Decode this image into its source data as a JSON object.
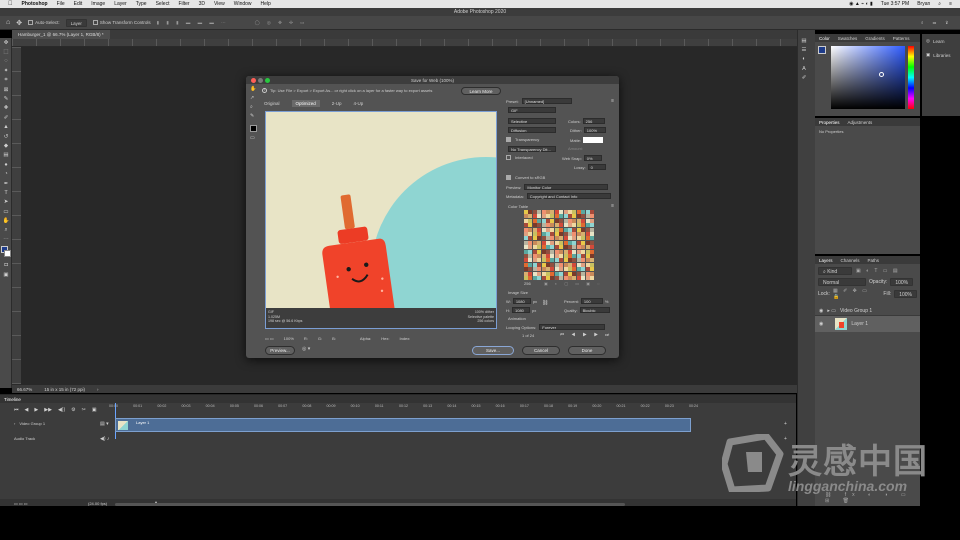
{
  "mac_menu": {
    "apple": "",
    "app": "Photoshop",
    "items": [
      "File",
      "Edit",
      "Image",
      "Layer",
      "Type",
      "Select",
      "Filter",
      "3D",
      "View",
      "Window",
      "Help"
    ],
    "time": "Tue 3:57 PM",
    "user": "Bryan"
  },
  "window_title": "Adobe Photoshop 2020",
  "options_bar": {
    "auto_select": "Auto-Select:",
    "layer_value": "Layer",
    "show_transform": "Show Transform Controls"
  },
  "doc_tab": "Hamburger_1 @ 66.7% (Layer 1, RGB/8) *",
  "doc_status": {
    "zoom": "66.67%",
    "info": "15 in x 15 in (72 ppi)"
  },
  "color_panel": {
    "tabs": [
      "Color",
      "Swatches",
      "Gradients",
      "Patterns"
    ]
  },
  "learn_panel": {
    "learn": "Learn",
    "libraries": "Libraries"
  },
  "properties_panel": {
    "tabs": [
      "Properties",
      "Adjustments"
    ],
    "message": "No Properties"
  },
  "layers_panel": {
    "tabs": [
      "Layers",
      "Channels",
      "Paths"
    ],
    "kind": "Kind",
    "blend": "Normal",
    "opacity_label": "Opacity:",
    "opacity_value": "100%",
    "lock_label": "Lock:",
    "fill_label": "Fill:",
    "fill_value": "100%",
    "group_name": "Video Group 1",
    "layer_name": "Layer 1"
  },
  "save_for_web": {
    "title": "Save for Web (100%)",
    "tip": "Tip: Use File > Export > Export As... or right click on a layer for a faster way to export assets",
    "learn_more": "Learn More",
    "view_tabs": [
      "Original",
      "Optimized",
      "2-Up",
      "4-Up"
    ],
    "preview_info_left": [
      "GIF",
      "1.025M",
      "198 sec @ 56.6 Kbps"
    ],
    "preview_info_right": [
      "100% dither",
      "Selective palette",
      "256 colors"
    ],
    "zoom": "100%",
    "preset_label": "Preset:",
    "preset_value": "[Unnamed]",
    "format": "GIF",
    "reduction": "Selective",
    "colors_label": "Colors:",
    "colors_value": "256",
    "dither_algo": "Diffusion",
    "dither_label": "Dither:",
    "dither_value": "100%",
    "transparency": "Transparency",
    "matte_label": "Matte:",
    "trans_dither": "No Transparency Dit...",
    "amount_label": "Amount:",
    "interlaced": "Interlaced",
    "websnap_label": "Web Snap:",
    "websnap_value": "0%",
    "lossy_label": "Lossy:",
    "lossy_value": "0",
    "convert_srgb": "Convert to sRGB",
    "preview_label": "Preview:",
    "preview_value": "Monitor Color",
    "metadata_label": "Metadata:",
    "metadata_value": "Copyright and Contact Info",
    "color_table": "Color Table",
    "palette_count": "256",
    "image_size": "Image Size",
    "w_label": "W:",
    "w_value": "1080",
    "h_label": "H:",
    "h_value": "1080",
    "unit": "px",
    "percent_label": "Percent:",
    "percent_value": "100",
    "percent_unit": "%",
    "quality_label": "Quality:",
    "quality_value": "Bicubic",
    "animation": "Animation",
    "looping_label": "Looping Options:",
    "looping_value": "Forever",
    "frame_counter": "1 of 24",
    "preview_btn": "Preview...",
    "save_btn": "Save...",
    "cancel_btn": "Cancel",
    "done_btn": "Done",
    "bottom_labels": [
      "R:",
      "G:",
      "B:",
      "Alpha:",
      "Hex:",
      "Index:"
    ]
  },
  "timeline": {
    "title": "Timeline",
    "ticks": [
      "00:00",
      "00:01",
      "00:02",
      "00:03",
      "00:04",
      "00:05",
      "00:06",
      "00:07",
      "00:08",
      "00:09",
      "00:10",
      "00:11",
      "00:12",
      "00:13",
      "00:14",
      "00:15",
      "00:16",
      "00:17",
      "00:18",
      "00:19",
      "00:20",
      "00:21",
      "00:22",
      "00:23",
      "00:24"
    ],
    "video_group": "Video Group 1",
    "audio_track": "Audio Track",
    "clip_name": "Layer 1",
    "fps": "(24.00 fps)"
  },
  "watermark": {
    "brand": "灵感中国",
    "url": "lingganchina.com"
  },
  "colors": {
    "canvas_bg": "#e8e4c6",
    "circle": "#8fd5d2",
    "bottle": "#f0432a",
    "watermark": "#8a8a8a"
  }
}
